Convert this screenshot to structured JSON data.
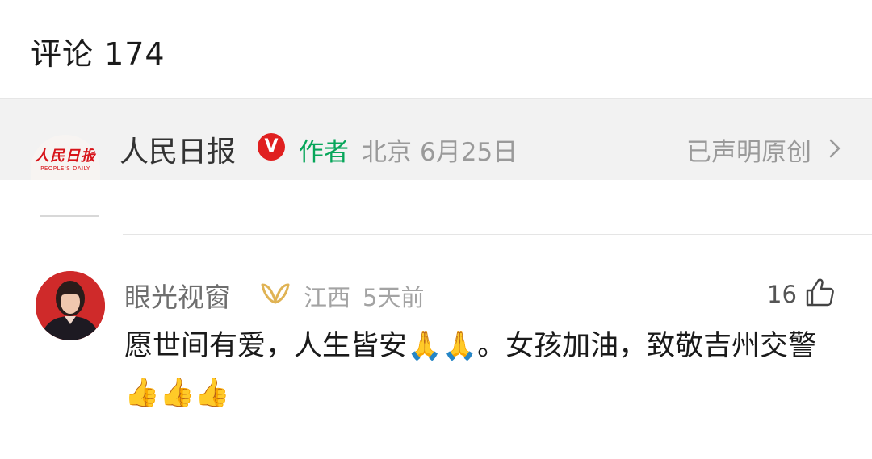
{
  "header": {
    "title": "评论 174"
  },
  "author_bar": {
    "logo_text_zh": "人民日报",
    "logo_text_en": "PEOPLE'S DAILY",
    "name": "人民日报",
    "verified_mark": "V",
    "tag": "作者",
    "location": "北京",
    "date": "6月25日",
    "original_statement": "已声明原创"
  },
  "comments": [
    {
      "name": "眼光视窗",
      "location": "江西",
      "time": "5天前",
      "likes": "16",
      "text": "愿世间有爱，人生皆安🙏🙏。女孩加油，致敬吉州交警👍👍👍"
    }
  ],
  "colors": {
    "accent_green": "#07a65a",
    "verified_red": "#e02020",
    "vip_gold": "#e0b354",
    "logo_red": "#d7141a"
  },
  "icons": [
    "verified-badge-icon",
    "chevron-right-icon",
    "vip-icon",
    "thumbs-up-icon"
  ]
}
